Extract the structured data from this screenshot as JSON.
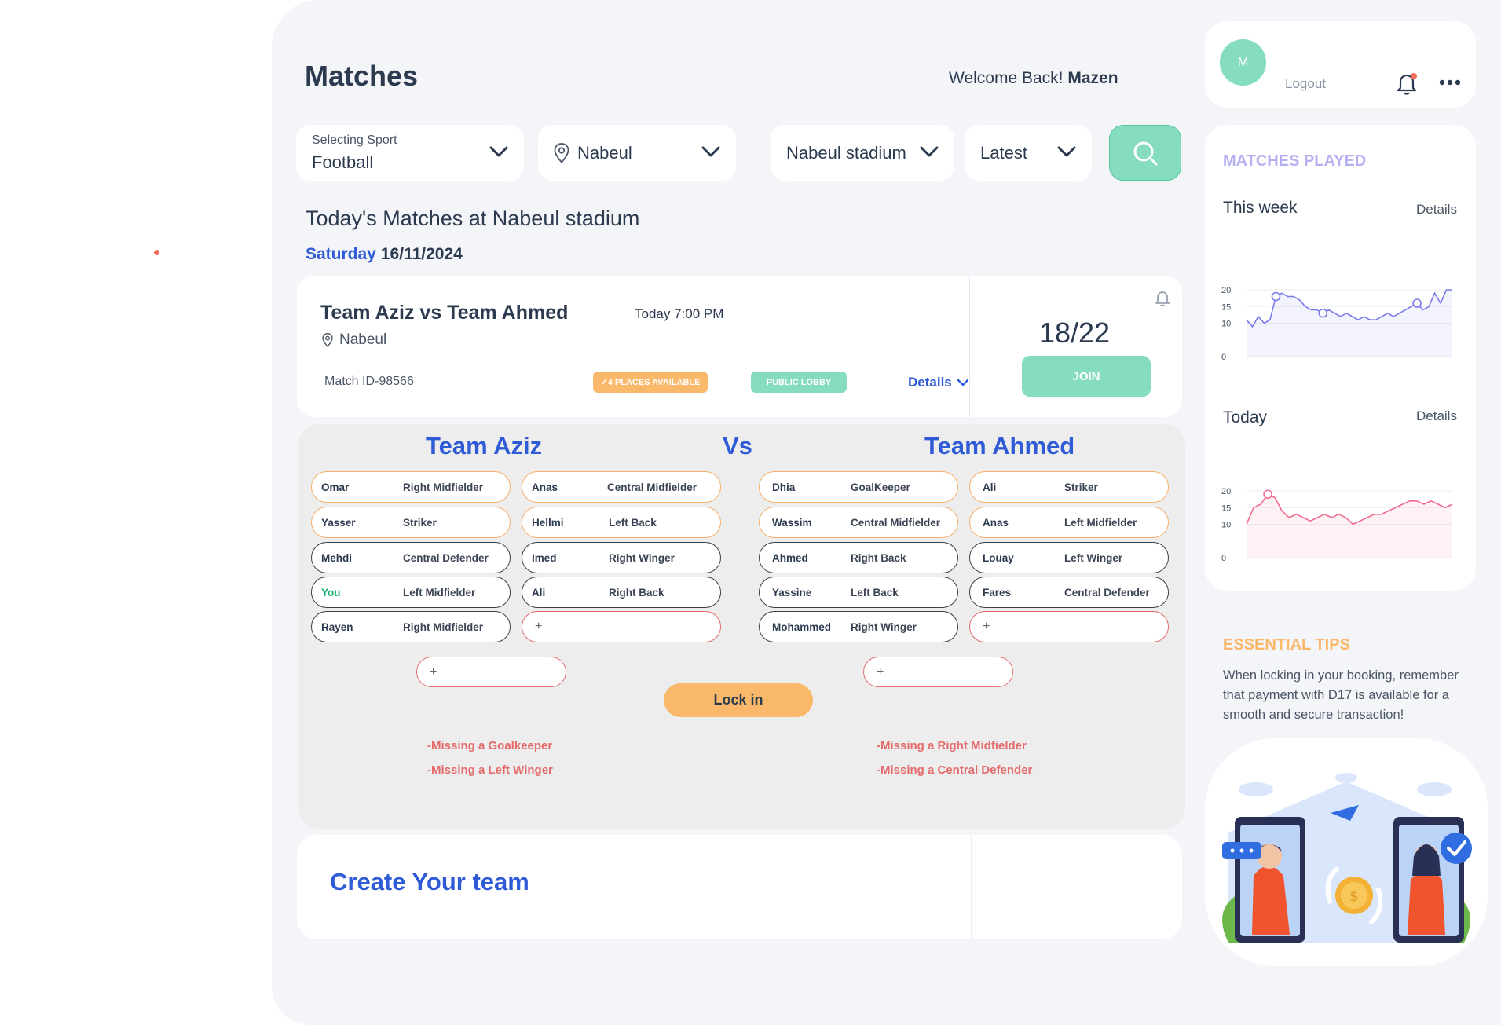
{
  "page": {
    "title": "Matches",
    "welcome_prefix": "Welcome Back!",
    "user_name": "Mazen"
  },
  "filters": {
    "sport_label": "Selecting Sport",
    "sport_value": "Football",
    "city_value": "Nabeul",
    "stadium_value": "Nabeul stadium",
    "sort_value": "Latest"
  },
  "listing": {
    "heading": "Today's Matches at Nabeul stadium",
    "day": "Saturday",
    "date": "16/11/2024"
  },
  "match": {
    "title": "Team Aziz vs Team Ahmed",
    "time": "Today 7:00 PM",
    "location": "Nabeul",
    "match_id": "Match ID-98566",
    "places_badge": "✓4 PLACES AVAILABLE",
    "lobby_badge": "PUBLIC LOBBY",
    "details_label": "Details",
    "player_count": "18/22",
    "join_label": "JOIN"
  },
  "lineup": {
    "team_left": "Team Aziz",
    "vs": "Vs",
    "team_right": "Team Ahmed",
    "left_col1": [
      {
        "name": "Omar",
        "position": "Right Midfielder"
      },
      {
        "name": "Yasser",
        "position": "Striker"
      },
      {
        "name": "Mehdi",
        "position": "Central Defender"
      },
      {
        "name": "You",
        "position": "Left Midfielder"
      },
      {
        "name": "Rayen",
        "position": "Right Midfielder"
      }
    ],
    "left_col2": [
      {
        "name": "Anas",
        "position": "Central Midfielder"
      },
      {
        "name": "Hellmi",
        "position": "Left Back"
      },
      {
        "name": "Imed",
        "position": "Right Winger"
      },
      {
        "name": "Ali",
        "position": "Right Back"
      }
    ],
    "right_col1": [
      {
        "name": "Dhia",
        "position": "GoalKeeper"
      },
      {
        "name": "Wassim",
        "position": "Central Midfielder"
      },
      {
        "name": "Ahmed",
        "position": "Right Back"
      },
      {
        "name": "Yassine",
        "position": "Left Back"
      },
      {
        "name": "Mohammed",
        "position": "Right Winger"
      }
    ],
    "right_col2": [
      {
        "name": "Ali",
        "position": "Striker"
      },
      {
        "name": "Anas",
        "position": "Left Midfielder"
      },
      {
        "name": "Louay",
        "position": "Left Winger"
      },
      {
        "name": "Fares",
        "position": "Central Defender"
      }
    ],
    "add_symbol": "+",
    "lock_label": "Lock in",
    "missing_left": [
      "-Missing a Goalkeeper",
      "-Missing a Left Winger"
    ],
    "missing_right": [
      "-Missing a Right Midfielder",
      "-Missing a Central Defender"
    ]
  },
  "create": {
    "title": "Create Your team"
  },
  "user": {
    "avatar_letter": "M",
    "logout_label": "Logout"
  },
  "stats": {
    "heading": "MATCHES PLAYED",
    "week_label": "This week",
    "week_details": "Details",
    "today_label": "Today",
    "today_details": "Details",
    "chart_data": [
      {
        "type": "line",
        "title": "This week",
        "ylim": [
          0,
          20
        ],
        "yticks": [
          0,
          10,
          15,
          20
        ],
        "color": "#7b7be8",
        "values": [
          11,
          9,
          12,
          10,
          11,
          18,
          19,
          18,
          18,
          17,
          15,
          14,
          14,
          13,
          14,
          13,
          12,
          13,
          12,
          11,
          12,
          11,
          11,
          12,
          13,
          12,
          13,
          14,
          15,
          16,
          14,
          15,
          19,
          16,
          20,
          20
        ],
        "markers": [
          5,
          13,
          29
        ]
      },
      {
        "type": "line",
        "title": "Today",
        "ylim": [
          0,
          20
        ],
        "yticks": [
          0,
          10,
          15,
          20
        ],
        "color": "#f06b8f",
        "values": [
          10,
          15,
          16,
          19,
          18,
          14,
          12,
          13,
          12,
          11,
          12,
          13,
          12,
          13,
          12,
          10,
          11,
          12,
          13,
          13,
          14,
          15,
          16,
          17,
          17,
          16,
          17,
          16,
          15,
          16
        ],
        "markers": [
          3
        ]
      }
    ]
  },
  "tips": {
    "heading": "ESSENTIAL TIPS",
    "text": "When locking in your booking, remember that payment with D17 is available for a smooth and secure transaction!"
  },
  "colors": {
    "accent_blue": "#2f5bd6",
    "mint": "#86dcbe",
    "orange": "#f9b86a",
    "missing_red": "#e36b6b",
    "lavender": "#b5b0f2"
  },
  "icons": [
    "location-pin-icon",
    "chevron-down-icon",
    "search-icon",
    "bell-icon",
    "more-dots-icon"
  ]
}
